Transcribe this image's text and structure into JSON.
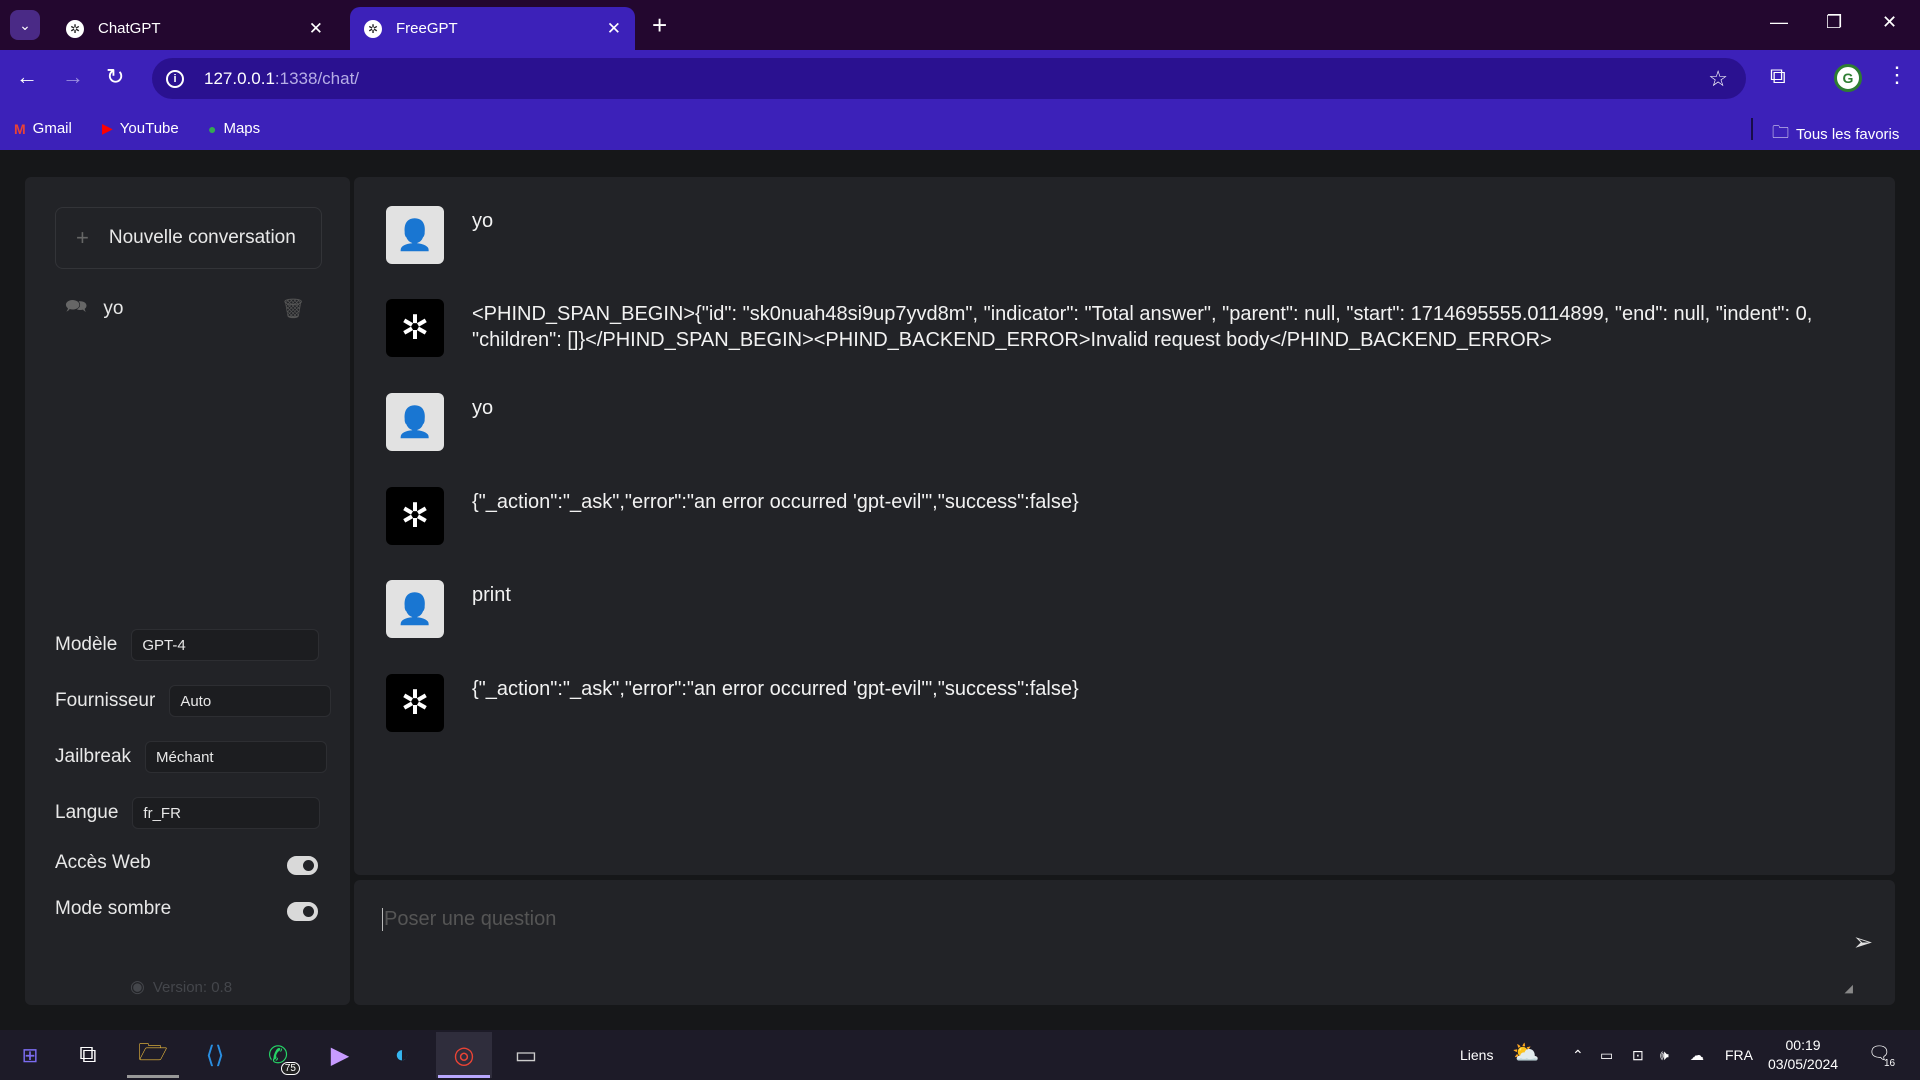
{
  "browser": {
    "tabs": [
      {
        "title": "ChatGPT",
        "icon": "chatgpt-icon"
      },
      {
        "title": "FreeGPT",
        "icon": "chatgpt-icon"
      }
    ],
    "url_host": "127.0.0.1",
    "url_path": ":1338/chat/",
    "bookmarks": [
      {
        "label": "Gmail",
        "icon": "gmail-icon",
        "color": "#ea4335"
      },
      {
        "label": "YouTube",
        "icon": "youtube-icon",
        "color": "#ff0000"
      },
      {
        "label": "Maps",
        "icon": "maps-icon",
        "color": "#34a853"
      }
    ],
    "all_bookmarks_label": "Tous les favoris"
  },
  "sidebar": {
    "new_conversation_label": "Nouvelle conversation",
    "conversations": [
      {
        "label": "yo"
      }
    ],
    "settings": {
      "model_label": "Modèle",
      "model_value": "GPT-4",
      "provider_label": "Fournisseur",
      "provider_value": "Auto",
      "jailbreak_label": "Jailbreak",
      "jailbreak_value": "Méchant",
      "language_label": "Langue",
      "language_value": "fr_FR",
      "web_access_label": "Accès Web",
      "web_access_on": true,
      "dark_mode_label": "Mode sombre",
      "dark_mode_on": true
    },
    "version": "Version: 0.8"
  },
  "messages": [
    {
      "role": "user",
      "text": "yo"
    },
    {
      "role": "assistant",
      "text": "<PHIND_SPAN_BEGIN>{\"id\": \"sk0nuah48si9up7yvd8m\", \"indicator\": \"Total answer\", \"parent\": null, \"start\": 1714695555.0114899, \"end\": null, \"indent\": 0, \"children\": []}</PHIND_SPAN_BEGIN><PHIND_BACKEND_ERROR>Invalid request body</PHIND_BACKEND_ERROR>"
    },
    {
      "role": "user",
      "text": "yo"
    },
    {
      "role": "assistant",
      "text": "{\"_action\":\"_ask\",\"error\":\"an error occurred 'gpt-evil'\",\"success\":false}"
    },
    {
      "role": "user",
      "text": "print"
    },
    {
      "role": "assistant",
      "text": "{\"_action\":\"_ask\",\"error\":\"an error occurred 'gpt-evil'\",\"success\":false}"
    }
  ],
  "input": {
    "placeholder": "Poser une question"
  },
  "taskbar": {
    "links_label": "Liens",
    "whatsapp_badge": "75",
    "language": "FRA",
    "time": "00:19",
    "date": "03/05/2024",
    "notifications": "16"
  },
  "colors": {
    "accent": "#3c21b9",
    "tabstrip": "#23072f",
    "panel": "#222327",
    "page_bg": "#161719"
  }
}
